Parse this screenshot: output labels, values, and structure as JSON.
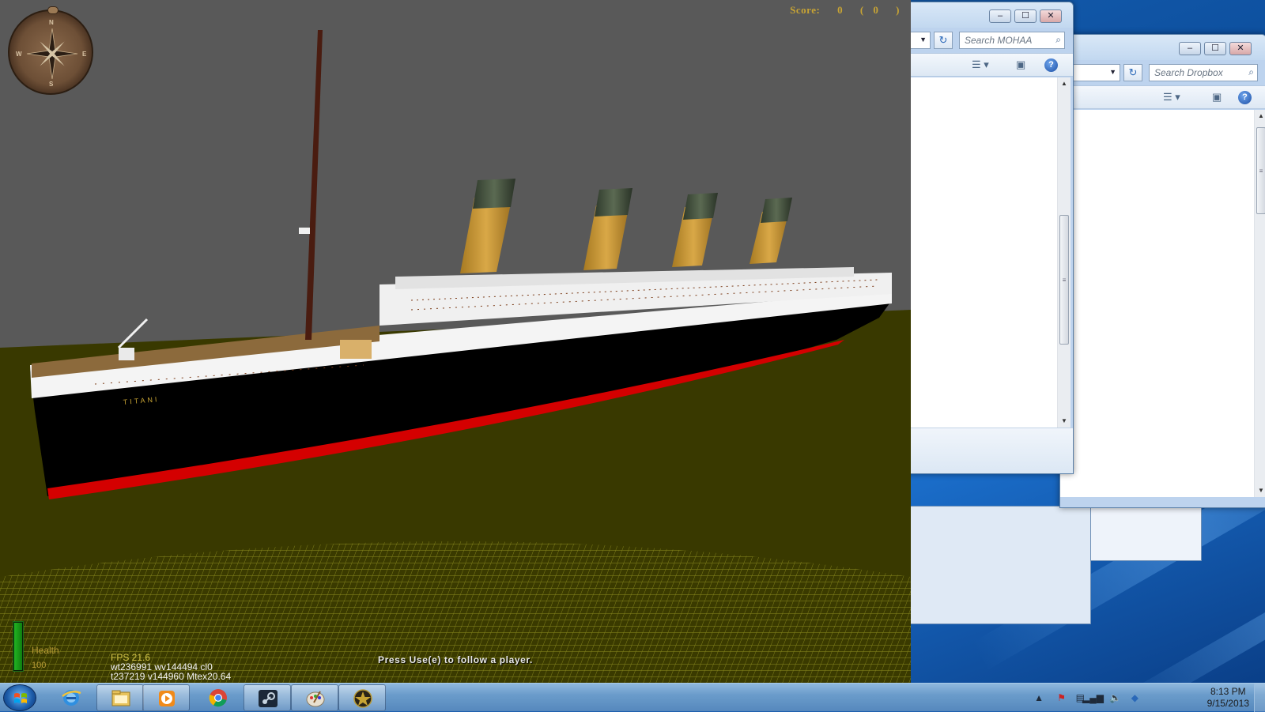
{
  "game": {
    "score_label": "Score:",
    "score_value": "0",
    "score_paren_open": "(",
    "score_secondary": "0",
    "score_paren_close": ")",
    "compass_dirs": {
      "n": "N",
      "e": "E",
      "s": "S",
      "w": "W"
    },
    "health_label": "Health",
    "health_value": "100",
    "health_fraction": 1.0,
    "stats": {
      "fps": "FPS 21.6",
      "line2": "wt236991 wv144494 cl0",
      "line3": "t237219 v144960 Mtex20.64"
    },
    "hint": "Press Use(e) to follow a player.",
    "ship_name": "TITANI"
  },
  "window_mohaa": {
    "search_placeholder": "Search MOHAA",
    "minimize": "–",
    "maximize": "☐",
    "close": "✕"
  },
  "window_dropbox": {
    "search_placeholder": "Search Dropbox",
    "minimize": "–",
    "maximize": "☐",
    "close": "✕"
  },
  "taskbar": {
    "items": [
      {
        "name": "internet-explorer",
        "active": false
      },
      {
        "name": "windows-explorer",
        "active": true
      },
      {
        "name": "media-player",
        "active": true
      },
      {
        "name": "google-chrome",
        "active": false
      },
      {
        "name": "steam",
        "active": true
      },
      {
        "name": "paint",
        "active": true
      },
      {
        "name": "medal-of-honor",
        "active": true
      }
    ],
    "clock_time": "8:13 PM",
    "clock_date": "9/15/2013",
    "show_hidden_icons": "▲"
  },
  "colors": {
    "sky": "#595959",
    "ground": "#3a3a00",
    "hull": "#000000",
    "boot_top": "#d40000",
    "funnel": "#c8922e",
    "score": "#c8a434"
  }
}
